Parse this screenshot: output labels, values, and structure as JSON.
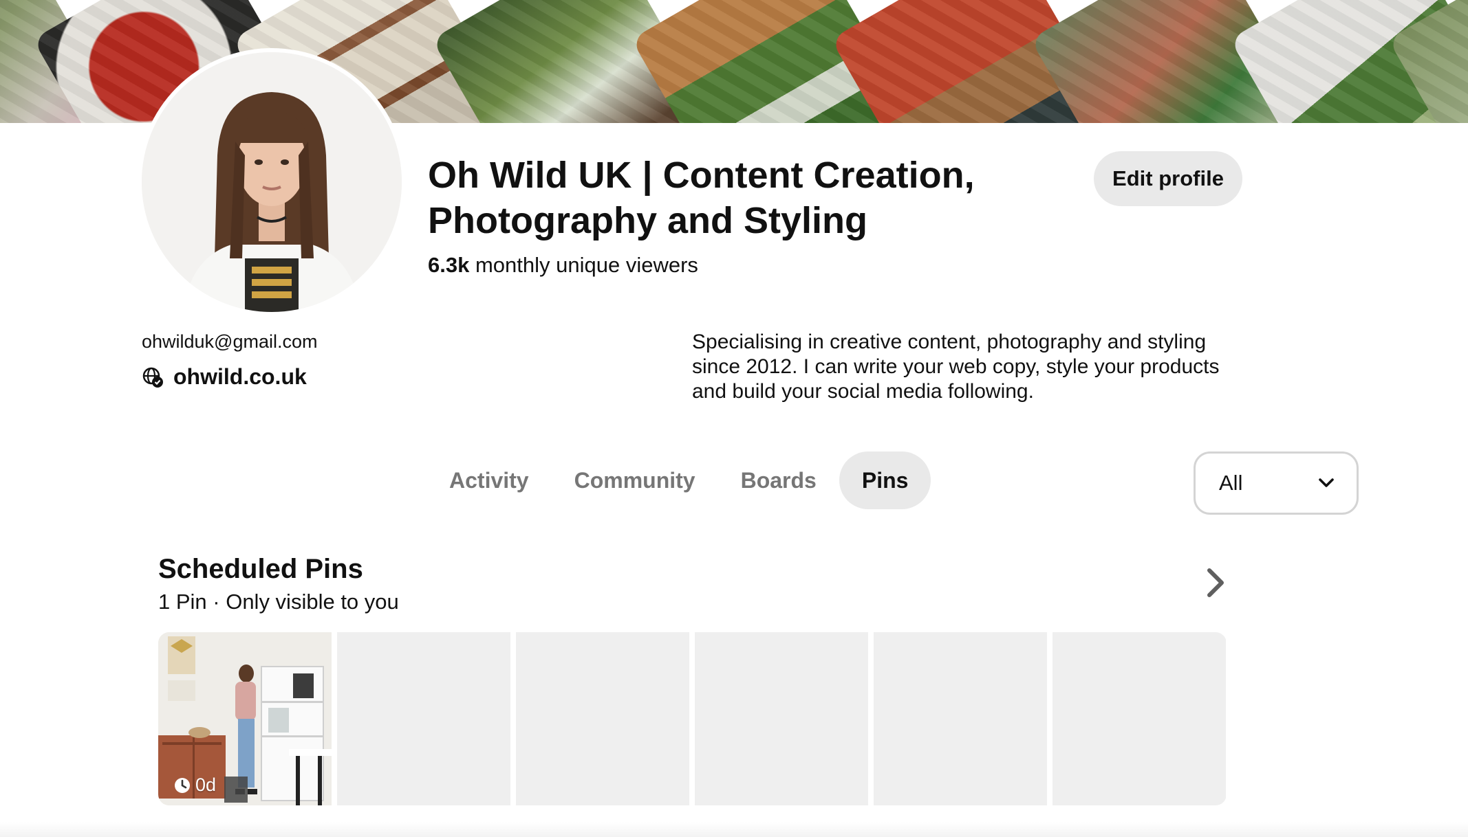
{
  "profile": {
    "name": "Oh Wild UK | Content Creation, Photography and Styling",
    "viewers_count": "6.3k",
    "viewers_label": " monthly unique viewers",
    "email": "ohwilduk@gmail.com",
    "website": "ohwild.co.uk",
    "bio": "Specialising in creative content, photography and styling since 2012. I can write your web copy, style your products and build your social media following.",
    "edit_button": "Edit profile"
  },
  "tabs": [
    {
      "label": "Activity",
      "active": false
    },
    {
      "label": "Community",
      "active": false
    },
    {
      "label": "Boards",
      "active": false
    },
    {
      "label": "Pins",
      "active": true
    }
  ],
  "filter": {
    "selected": "All",
    "icon": "chevron-down-icon"
  },
  "scheduled": {
    "title": "Scheduled Pins",
    "subtitle": "1 Pin · Only visible to you",
    "arrow_icon": "chevron-right-icon",
    "pins": [
      {
        "badge": "0d",
        "icon": "clock-icon"
      }
    ],
    "placeholder_count": 5
  },
  "colors": {
    "text": "#111111",
    "muted_text": "#767676",
    "pill_bg": "#e9e9e9",
    "placeholder_bg": "#efefef",
    "border": "#d4d4d4"
  }
}
